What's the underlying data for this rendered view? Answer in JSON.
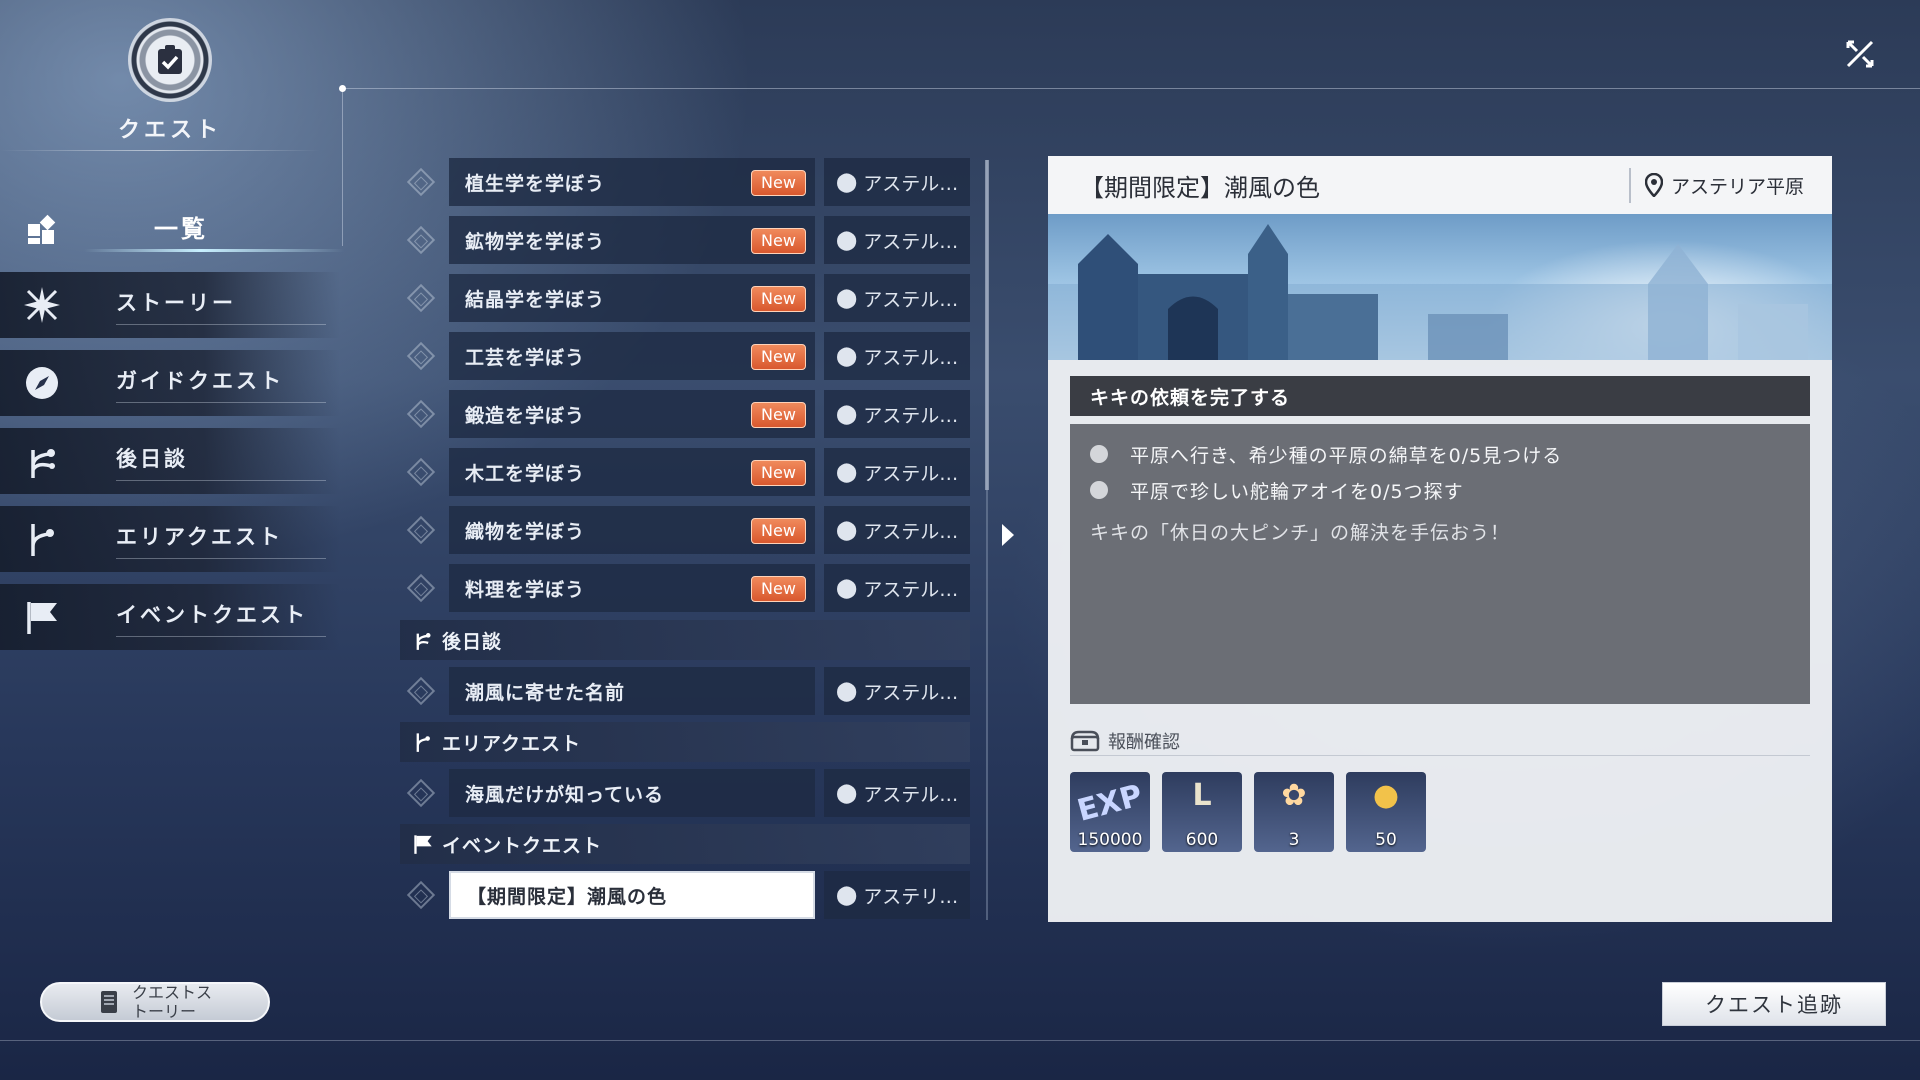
{
  "header": {
    "title": "クエスト",
    "close_icon": "close-icon"
  },
  "sidebar": {
    "items": [
      {
        "label": "一覧",
        "icon": "grid-icon",
        "active": true
      },
      {
        "label": "ストーリー",
        "icon": "starburst-icon"
      },
      {
        "label": "ガイドクエスト",
        "icon": "compass-icon"
      },
      {
        "label": "後日談",
        "icon": "branch-icon"
      },
      {
        "label": "エリアクエスト",
        "icon": "branch-flag-icon"
      },
      {
        "label": "イベントクエスト",
        "icon": "flag-icon"
      }
    ]
  },
  "quest_list": {
    "quests": [
      {
        "name": "植生学を学ぼう",
        "badge": "New",
        "location": "アステル…"
      },
      {
        "name": "鉱物学を学ぼう",
        "badge": "New",
        "location": "アステル…"
      },
      {
        "name": "結晶学を学ぼう",
        "badge": "New",
        "location": "アステル…"
      },
      {
        "name": "工芸を学ぼう",
        "badge": "New",
        "location": "アステル…"
      },
      {
        "name": "鍛造を学ぼう",
        "badge": "New",
        "location": "アステル…"
      },
      {
        "name": "木工を学ぼう",
        "badge": "New",
        "location": "アステル…"
      },
      {
        "name": "織物を学ぼう",
        "badge": "New",
        "location": "アステル…"
      },
      {
        "name": "料理を学ぼう",
        "badge": "New",
        "location": "アステル…"
      }
    ],
    "categories": {
      "epilogue": {
        "label": "後日談",
        "quests": [
          {
            "name": "潮風に寄せた名前",
            "location": "アステル…"
          }
        ]
      },
      "area": {
        "label": "エリアクエスト",
        "quests": [
          {
            "name": "海風だけが知っている",
            "location": "アステル…"
          }
        ]
      },
      "event": {
        "label": "イベントクエスト",
        "quests": [
          {
            "name": "【期間限定】潮風の色",
            "location": "アステリ…",
            "selected": true
          }
        ]
      }
    }
  },
  "detail": {
    "title": "【期間限定】潮風の色",
    "location": "アステリア平原",
    "objective_title": "キキの依頼を完了する",
    "objectives": [
      "平原へ行き、希少種の平原の綿草を0/5見つける",
      "平原で珍しい舵輪アオイを0/5つ探す"
    ],
    "description": "キキの「休日の大ピンチ」の解決を手伝おう！",
    "rewards_label": "報酬確認",
    "rewards": [
      {
        "icon": "exp-icon",
        "glyph": "EXP",
        "qty": "150000"
      },
      {
        "icon": "coin-l-icon",
        "glyph": "L",
        "qty": "600"
      },
      {
        "icon": "gift-items-icon",
        "glyph": "✿",
        "qty": "3"
      },
      {
        "icon": "gold-coin-icon",
        "glyph": "●",
        "qty": "50"
      }
    ]
  },
  "footer": {
    "story_button": "クエストス\nトーリー",
    "track_button": "クエスト追跡"
  },
  "colors": {
    "new_badge": "#e0643a",
    "panel_bg": "#eef0f4",
    "objective_header": "#3a3d44"
  }
}
